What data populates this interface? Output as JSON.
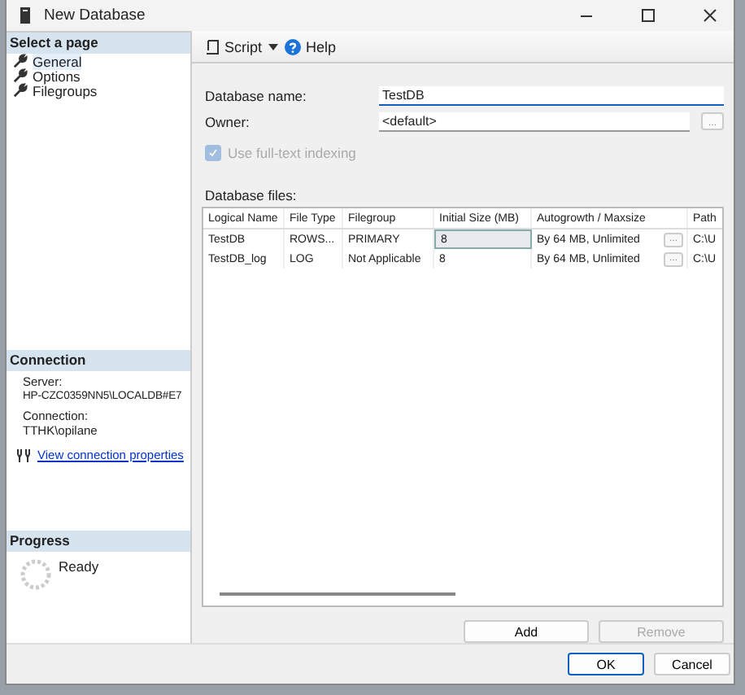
{
  "window": {
    "title": "New Database"
  },
  "sidebar": {
    "header": "Select a page",
    "items": [
      {
        "label": "General",
        "selected": true
      },
      {
        "label": "Options",
        "selected": false
      },
      {
        "label": "Filegroups",
        "selected": false
      }
    ]
  },
  "connection": {
    "header": "Connection",
    "server_label": "Server:",
    "server": "HP-CZC0359NN5\\LOCALDB#E7",
    "connection_label": "Connection:",
    "user": "TTHK\\opilane",
    "link": "View connection properties"
  },
  "progress": {
    "header": "Progress",
    "status": "Ready"
  },
  "toolbar": {
    "script": "Script",
    "help": "Help"
  },
  "form": {
    "name_label": "Database name:",
    "name_value": "TestDB",
    "owner_label": "Owner:",
    "owner_value": "<default>",
    "browse": "...",
    "fulltext": {
      "label": "Use full-text indexing",
      "checked": true,
      "disabled": true
    }
  },
  "files": {
    "label": "Database files:",
    "columns": [
      "Logical Name",
      "File Type",
      "Filegroup",
      "Initial Size (MB)",
      "Autogrowth / Maxsize",
      "Path"
    ],
    "rows": [
      {
        "cells": [
          "TestDB",
          "ROWS...",
          "PRIMARY",
          "8",
          "By 64 MB, Unlimited",
          "C:\\U"
        ],
        "browse": "...",
        "size_selected": true
      },
      {
        "cells": [
          "TestDB_log",
          "LOG",
          "Not Applicable",
          "8",
          "By 64 MB, Unlimited",
          "C:\\U"
        ],
        "browse": "...",
        "size_selected": false
      }
    ]
  },
  "add_button": {
    "label": "Add",
    "disabled": false
  },
  "remove_button": {
    "label": "Remove",
    "disabled": true
  },
  "buttons": [
    {
      "label": "OK",
      "default": true
    },
    {
      "label": "Cancel",
      "default": false
    }
  ]
}
